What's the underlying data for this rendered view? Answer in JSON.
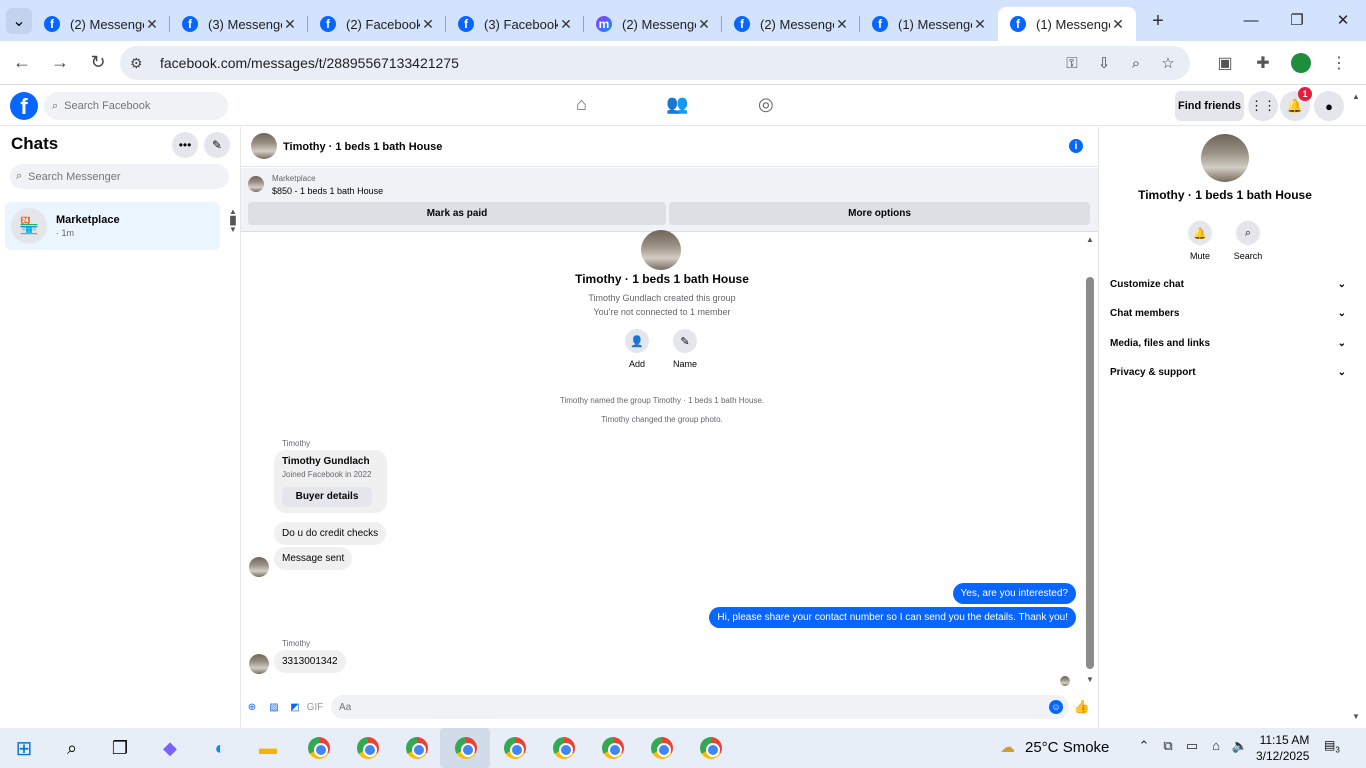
{
  "browser": {
    "tabs": [
      {
        "title": "(2) Messenger",
        "icon": "facebook"
      },
      {
        "title": "(3) Messenger",
        "icon": "facebook"
      },
      {
        "title": "(2) Facebook",
        "icon": "facebook"
      },
      {
        "title": "(3) Facebook",
        "icon": "facebook"
      },
      {
        "title": "(2) Messenger",
        "icon": "messenger"
      },
      {
        "title": "(2) Messenger",
        "icon": "facebook"
      },
      {
        "title": "(1) Messenger",
        "icon": "facebook"
      },
      {
        "title": "(1) Messenger",
        "icon": "facebook"
      }
    ],
    "active_tab": 7,
    "url": "facebook.com/messages/t/28895567133421275"
  },
  "fb_header": {
    "search_placeholder": "Search Facebook",
    "find_friends": "Find friends",
    "notification_count": "1"
  },
  "left": {
    "title": "Chats",
    "search_placeholder": "Search Messenger",
    "chats": [
      {
        "name": "Marketplace",
        "time": "· 1m"
      }
    ]
  },
  "conversation": {
    "title": "Timothy · 1 beds 1 bath House",
    "marketplace_label": "Marketplace",
    "listing": "$850 - 1 beds 1 bath House",
    "mark_paid": "Mark as paid",
    "more_options": "More options",
    "group_title": "Timothy · 1 beds 1 bath House",
    "created": "Timothy Gundlach created this group",
    "connection": "You're not connected to 1 member",
    "add_label": "Add",
    "name_label": "Name",
    "system_msgs": [
      "Timothy named the group Timothy · 1 beds 1 bath House.",
      "Timothy changed the group photo."
    ],
    "sender1": "Timothy",
    "buyer_name": "Timothy Gundlach",
    "buyer_joined": "Joined Facebook in 2022",
    "buyer_details": "Buyer details",
    "msg_credit": "Do u do credit checks",
    "msg_sent": "Message sent",
    "out_msg1": "Yes, are you interested?",
    "out_msg2": "Hi, please share your contact number so I can send you the details. Thank you!",
    "sender2": "Timothy",
    "msg_number": "3313001342",
    "composer_placeholder": "Aa"
  },
  "right": {
    "name": "Timothy · 1 beds 1 bath House",
    "mute": "Mute",
    "search": "Search",
    "sections": [
      "Customize chat",
      "Chat members",
      "Media, files and links",
      "Privacy & support"
    ]
  },
  "taskbar": {
    "temperature": "25°C",
    "weather": "Smoke",
    "time": "11:15 AM",
    "date": "3/12/2025",
    "notifications": "3"
  },
  "colors": {
    "accent": "#0866ff",
    "tabstrip": "#d3e3fd"
  }
}
